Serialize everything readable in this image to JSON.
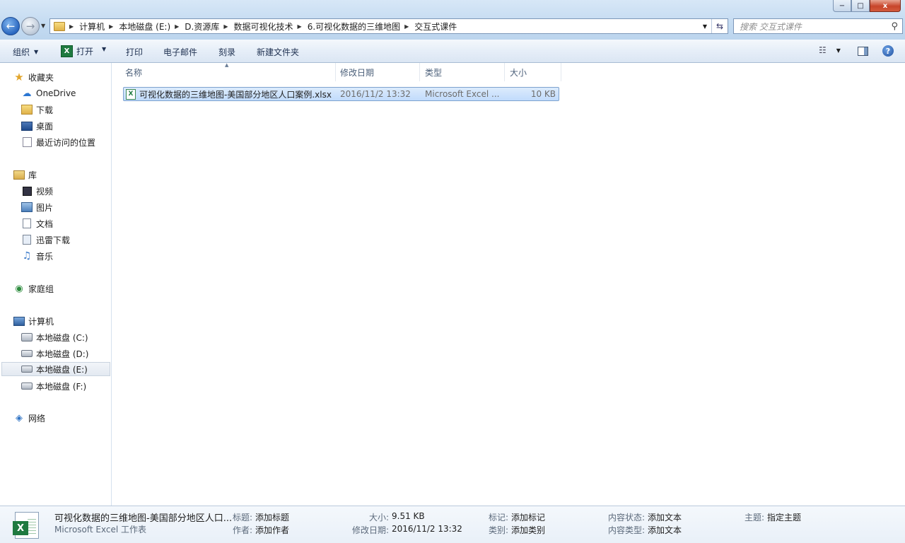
{
  "window": {
    "minimize": "−",
    "maximize": "□",
    "close": "x"
  },
  "address": {
    "crumbs": [
      "计算机",
      "本地磁盘 (E:)",
      "D.资源库",
      "数据可视化技术",
      "6.可视化数据的三维地图",
      "交互式课件"
    ]
  },
  "search": {
    "placeholder": "搜索 交互式课件"
  },
  "toolbar": {
    "organize": "组织",
    "open": "打开",
    "print": "打印",
    "email": "电子邮件",
    "burn": "刻录",
    "new_folder": "新建文件夹"
  },
  "nav": {
    "favorites": "收藏夹",
    "onedrive": "OneDrive",
    "downloads": "下载",
    "desktop": "桌面",
    "recent": "最近访问的位置",
    "libraries": "库",
    "videos": "视频",
    "pictures": "图片",
    "documents": "文档",
    "xunlei": "迅雷下载",
    "music": "音乐",
    "homegroup": "家庭组",
    "computer": "计算机",
    "drive_c": "本地磁盘 (C:)",
    "drive_d": "本地磁盘 (D:)",
    "drive_e": "本地磁盘 (E:)",
    "drive_f": "本地磁盘 (F:)",
    "network": "网络"
  },
  "columns": {
    "name": "名称",
    "modified": "修改日期",
    "type": "类型",
    "size": "大小"
  },
  "files": [
    {
      "name": "可视化数据的三维地图-美国部分地区人口案例.xlsx",
      "modified": "2016/11/2 13:32",
      "type": "Microsoft Excel ...",
      "size": "10 KB"
    }
  ],
  "details": {
    "filename": "可视化数据的三维地图-美国部分地区人口...",
    "filetype": "Microsoft Excel 工作表",
    "title_label": "标题:",
    "title_value": "添加标题",
    "author_label": "作者:",
    "author_value": "添加作者",
    "size_label": "大小:",
    "size_value": "9.51 KB",
    "modified_label": "修改日期:",
    "modified_value": "2016/11/2 13:32",
    "tags_label": "标记:",
    "tags_value": "添加标记",
    "category_label": "类别:",
    "category_value": "添加类别",
    "status_label": "内容状态:",
    "status_value": "添加文本",
    "content_type_label": "内容类型:",
    "content_type_value": "添加文本",
    "subject_label": "主题:",
    "subject_value": "指定主题"
  }
}
